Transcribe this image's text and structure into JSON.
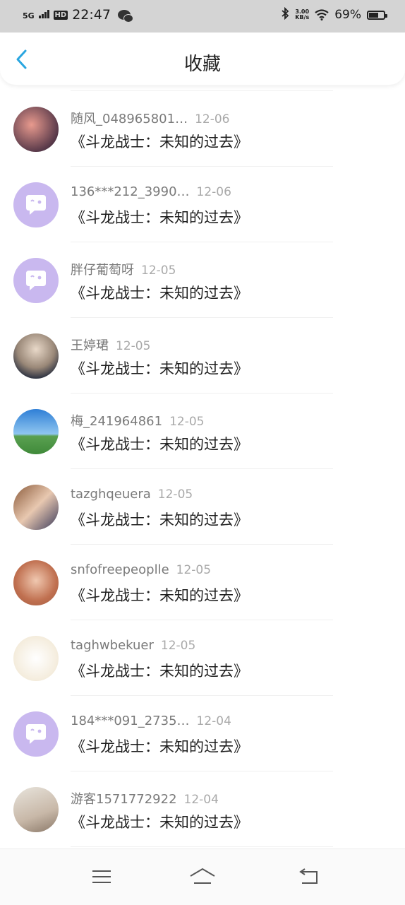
{
  "status_bar": {
    "network": "5G",
    "hd": "HD",
    "time": "22:47",
    "speed_value": "3.00",
    "speed_unit": "KB/s",
    "battery": "69%",
    "battery_level": 0.69,
    "icons": [
      "signal-icon",
      "wechat-icon",
      "bluetooth-icon",
      "wifi-icon",
      "battery-icon"
    ]
  },
  "header": {
    "title": "收藏",
    "back_icon": "chevron-left-icon",
    "accent_color": "#2aa6e0"
  },
  "favorites": [
    {
      "name": "随风_048965801…",
      "date": "12-06",
      "book": "《斗龙战士：未知的过去》",
      "avatar": "photo"
    },
    {
      "name": "136***212_3990…",
      "date": "12-06",
      "book": "《斗龙战士：未知的过去》",
      "avatar": "default"
    },
    {
      "name": "胖仔葡萄呀",
      "date": "12-05",
      "book": "《斗龙战士：未知的过去》",
      "avatar": "default"
    },
    {
      "name": "王婷珺",
      "date": "12-05",
      "book": "《斗龙战士：未知的过去》",
      "avatar": "photo"
    },
    {
      "name": "梅_241964861",
      "date": "12-05",
      "book": "《斗龙战士：未知的过去》",
      "avatar": "photo"
    },
    {
      "name": "tazghqeuera",
      "date": "12-05",
      "book": "《斗龙战士：未知的过去》",
      "avatar": "photo"
    },
    {
      "name": "snfofreepeoplle",
      "date": "12-05",
      "book": "《斗龙战士：未知的过去》",
      "avatar": "photo"
    },
    {
      "name": "taghwbekuer",
      "date": "12-05",
      "book": "《斗龙战士：未知的过去》",
      "avatar": "photo"
    },
    {
      "name": "184***091_2735…",
      "date": "12-04",
      "book": "《斗龙战士：未知的过去》",
      "avatar": "default"
    },
    {
      "name": "游客1571772922",
      "date": "12-04",
      "book": "《斗龙战士：未知的过去》",
      "avatar": "photo"
    }
  ],
  "system_nav": {
    "menu_icon": "menu-icon",
    "home_icon": "home-icon",
    "back_icon": "back-icon"
  }
}
